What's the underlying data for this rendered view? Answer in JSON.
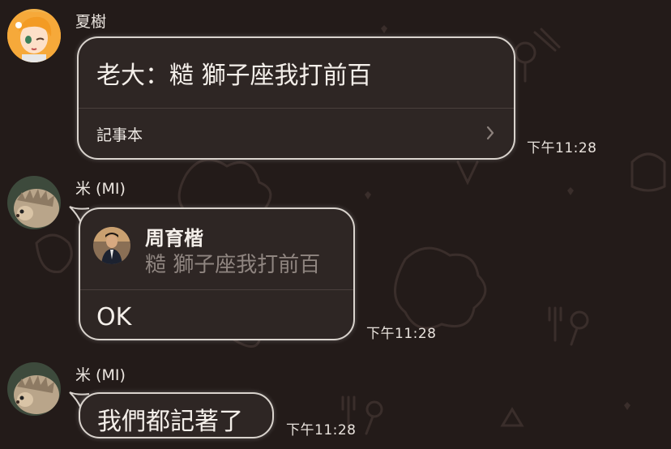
{
  "messages": [
    {
      "sender": "夏樹",
      "text": "老大：糙 獅子座我打前百",
      "link_label": "記事本",
      "time": "下午11:28"
    },
    {
      "sender": "米 (MI)",
      "quote_author": "周育楷",
      "quote_text": "糙 獅子座我打前百",
      "text": "OK",
      "time": "下午11:28"
    },
    {
      "sender": "米 (MI)",
      "text": "我們都記著了",
      "time": "下午11:28"
    }
  ],
  "icons": {
    "link_chevron": "chevron-right-icon"
  }
}
